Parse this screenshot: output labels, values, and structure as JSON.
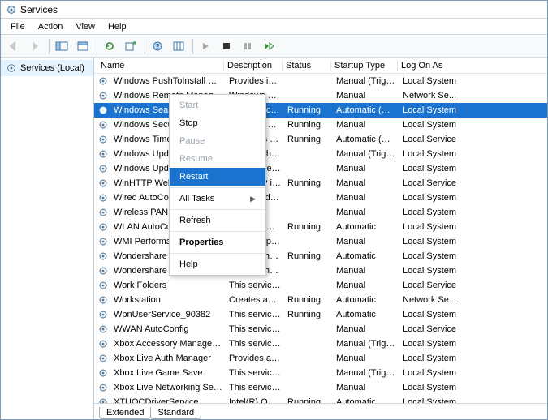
{
  "window": {
    "title": "Services"
  },
  "menu": [
    "File",
    "Action",
    "View",
    "Help"
  ],
  "tree": {
    "root": "Services (Local)"
  },
  "columns": [
    "Name",
    "Description",
    "Status",
    "Startup Type",
    "Log On As"
  ],
  "tabs": [
    "Extended",
    "Standard"
  ],
  "active_tab": 1,
  "context_menu": {
    "items": [
      "Start",
      "Stop",
      "Pause",
      "Resume",
      "Restart"
    ],
    "items2": [
      "All Tasks"
    ],
    "items3": [
      "Refresh"
    ],
    "items4": [
      "Properties"
    ],
    "items5": [
      "Help"
    ],
    "highlight": "Restart",
    "disabled": [
      "Start",
      "Pause",
      "Resume"
    ]
  },
  "selected_row": 2,
  "services": [
    {
      "n": "Windows PushToInstall Servi...",
      "d": "Provides infr...",
      "s": "",
      "t": "Manual (Trigg...",
      "l": "Local System"
    },
    {
      "n": "Windows Remote Managem...",
      "d": "Windows Re...",
      "s": "",
      "t": "Manual",
      "l": "Network Se..."
    },
    {
      "n": "Windows Search",
      "d": "Provides con...",
      "s": "Running",
      "t": "Automatic (De...",
      "l": "Local System"
    },
    {
      "n": "Windows Security Service",
      "d": "Windows Se...",
      "s": "Running",
      "t": "Manual",
      "l": "Local System"
    },
    {
      "n": "Windows Time",
      "d": "Maintains d...",
      "s": "Running",
      "t": "Automatic (De...",
      "l": "Local Service"
    },
    {
      "n": "Windows Update",
      "d": "Enables the ...",
      "s": "",
      "t": "Manual (Trigg...",
      "l": "Local System"
    },
    {
      "n": "Windows Update Medic Service",
      "d": "Enables rem...",
      "s": "",
      "t": "Manual",
      "l": "Local System"
    },
    {
      "n": "WinHTTP Web Proxy Auto-...",
      "d": "WinHTTP im...",
      "s": "Running",
      "t": "Manual",
      "l": "Local Service"
    },
    {
      "n": "Wired AutoConfig",
      "d": "The Wired A...",
      "s": "",
      "t": "Manual",
      "l": "Local System"
    },
    {
      "n": "Wireless PAN DHCP Server",
      "d": "",
      "s": "",
      "t": "Manual",
      "l": "Local System"
    },
    {
      "n": "WLAN AutoConfig",
      "d": "The WLANS...",
      "s": "Running",
      "t": "Automatic",
      "l": "Local System"
    },
    {
      "n": "WMI Performance Adapter",
      "d": "Provides pe...",
      "s": "",
      "t": "Manual",
      "l": "Local System"
    },
    {
      "n": "Wondershare Application Fra...",
      "d": "Wondershare",
      "s": "Running",
      "t": "Automatic",
      "l": "Local System"
    },
    {
      "n": "Wondershare Application Up...",
      "d": "Wondershare",
      "s": "",
      "t": "Manual",
      "l": "Local System"
    },
    {
      "n": "Work Folders",
      "d": "This service ...",
      "s": "",
      "t": "Manual",
      "l": "Local Service"
    },
    {
      "n": "Workstation",
      "d": "Creates and ...",
      "s": "Running",
      "t": "Automatic",
      "l": "Network Se..."
    },
    {
      "n": "WpnUserService_90382",
      "d": "This service ...",
      "s": "Running",
      "t": "Automatic",
      "l": "Local System"
    },
    {
      "n": "WWAN AutoConfig",
      "d": "This service ...",
      "s": "",
      "t": "Manual",
      "l": "Local Service"
    },
    {
      "n": "Xbox Accessory Managemen...",
      "d": "This service ...",
      "s": "",
      "t": "Manual (Trigg...",
      "l": "Local System"
    },
    {
      "n": "Xbox Live Auth Manager",
      "d": "Provides aut...",
      "s": "",
      "t": "Manual",
      "l": "Local System"
    },
    {
      "n": "Xbox Live Game Save",
      "d": "This service ...",
      "s": "",
      "t": "Manual (Trigg...",
      "l": "Local System"
    },
    {
      "n": "Xbox Live Networking Service",
      "d": "This service ...",
      "s": "",
      "t": "Manual",
      "l": "Local System"
    },
    {
      "n": "XTUOCDriverService",
      "d": "Intel(R) Over...",
      "s": "Running",
      "t": "Automatic",
      "l": "Local System"
    }
  ]
}
